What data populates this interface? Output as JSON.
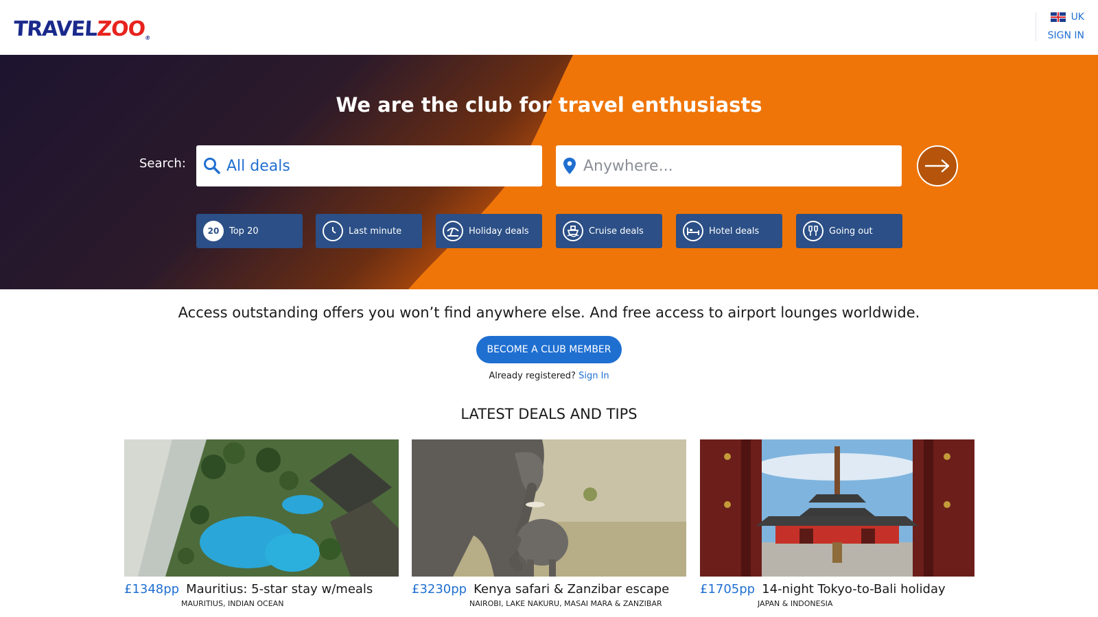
{
  "header": {
    "logo_part1": "TRAVEL",
    "logo_part2": "ZOO",
    "logo_reg": "®",
    "region": "UK",
    "sign_in": "SIGN IN"
  },
  "hero": {
    "title": "We are the club for travel enthusiasts",
    "search_label": "Search:",
    "what_value": "All deals",
    "where_placeholder": "Anywhere...",
    "quick_links": [
      {
        "label": "Top 20",
        "icon": "top20-icon",
        "icon_text": "20"
      },
      {
        "label": "Last minute",
        "icon": "clock-icon"
      },
      {
        "label": "Holiday deals",
        "icon": "beach-icon"
      },
      {
        "label": "Cruise deals",
        "icon": "ship-icon"
      },
      {
        "label": "Hotel deals",
        "icon": "bed-icon"
      },
      {
        "label": "Going out",
        "icon": "glasses-icon"
      }
    ]
  },
  "intro": {
    "text": "Access outstanding offers you won’t find anywhere else. And free access to airport lounges worldwide.",
    "cta": "BECOME A CLUB MEMBER",
    "already": "Already registered?",
    "sign_in_link": "Sign In"
  },
  "deals": {
    "section_title": "LATEST DEALS AND TIPS",
    "cards": [
      {
        "price": "£1348pp",
        "title": "Mauritius: 5-star stay w/meals",
        "location": "MAURITIUS, INDIAN OCEAN"
      },
      {
        "price": "£3230pp",
        "title": "Kenya safari & Zanzibar escape",
        "location": "NAIROBI, LAKE NAKURU, MASAI MARA & ZANZIBAR"
      },
      {
        "price": "£1705pp",
        "title": "14-night Tokyo-to-Bali holiday",
        "location": "JAPAN & INDONESIA"
      }
    ]
  },
  "colors": {
    "brand_blue": "#1f6fd1",
    "hero_orange": "#ee7208",
    "hero_dark": "#23152a",
    "quick_link_bg": "#2b4f86"
  }
}
